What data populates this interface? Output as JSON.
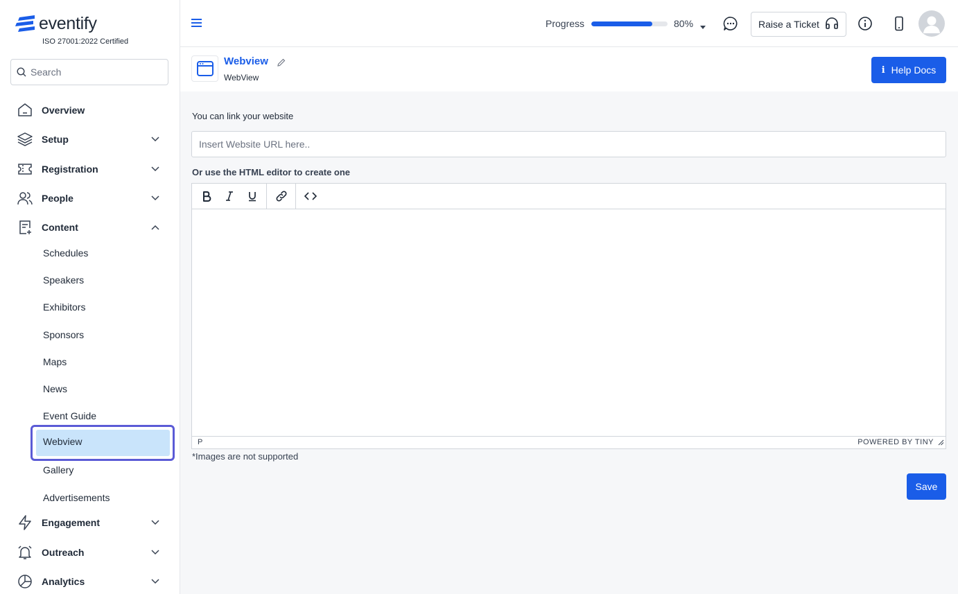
{
  "brand": {
    "name": "eventify",
    "certification": "ISO 27001:2022 Certified",
    "accent": "#1a5de8"
  },
  "search": {
    "placeholder": "Search"
  },
  "nav": {
    "overview": "Overview",
    "setup": "Setup",
    "registration": "Registration",
    "people": "People",
    "content": "Content",
    "content_items": [
      "Schedules",
      "Speakers",
      "Exhibitors",
      "Sponsors",
      "Maps",
      "News",
      "Event Guide",
      "Webview",
      "Gallery",
      "Advertisements"
    ],
    "engagement": "Engagement",
    "outreach": "Outreach",
    "analytics": "Analytics"
  },
  "topbar": {
    "progress_label": "Progress",
    "progress_percent": "80%",
    "progress_value": 0.8,
    "raise_ticket": "Raise a Ticket"
  },
  "page": {
    "title": "Webview",
    "subtitle": "WebView",
    "help_docs": "Help Docs"
  },
  "form": {
    "link_label": "You can link your website",
    "url_placeholder": "Insert Website URL here..",
    "editor_label": "Or use the HTML editor to create one",
    "status_path": "P",
    "powered_by": "POWERED BY TINY",
    "images_note": "*Images are not supported",
    "save": "Save"
  }
}
